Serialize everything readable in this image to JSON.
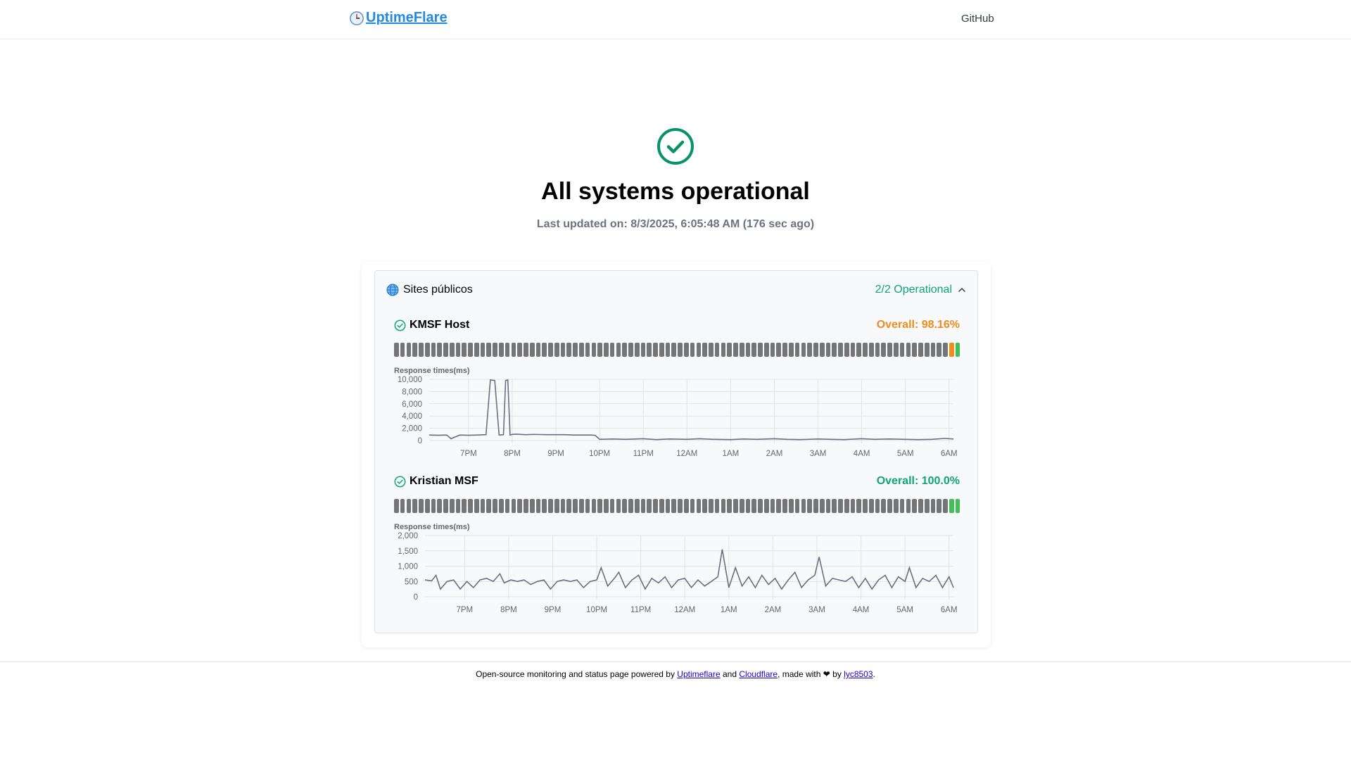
{
  "header": {
    "brand": "UptimeFlare",
    "github_label": "GitHub"
  },
  "hero": {
    "title": "All systems operational",
    "subtitle": "Last updated on: 8/3/2025, 6:05:48 AM (176 sec ago)"
  },
  "group": {
    "title": "Sites públicos",
    "status": "2/2 Operational"
  },
  "monitors": [
    {
      "name": "KMSF Host",
      "overall": "Overall: 98.16%",
      "overall_color": "#f08c1e",
      "response_label": "Response times(ms)",
      "bars": [
        "gray",
        "gray",
        "gray",
        "gray",
        "gray",
        "gray",
        "gray",
        "gray",
        "gray",
        "gray",
        "gray",
        "gray",
        "gray",
        "gray",
        "gray",
        "gray",
        "gray",
        "gray",
        "gray",
        "gray",
        "gray",
        "gray",
        "gray",
        "gray",
        "gray",
        "gray",
        "gray",
        "gray",
        "gray",
        "gray",
        "gray",
        "gray",
        "gray",
        "gray",
        "gray",
        "gray",
        "gray",
        "gray",
        "gray",
        "gray",
        "gray",
        "gray",
        "gray",
        "gray",
        "gray",
        "gray",
        "gray",
        "gray",
        "gray",
        "gray",
        "gray",
        "gray",
        "gray",
        "gray",
        "gray",
        "gray",
        "gray",
        "gray",
        "gray",
        "gray",
        "gray",
        "gray",
        "gray",
        "gray",
        "gray",
        "gray",
        "gray",
        "gray",
        "gray",
        "gray",
        "gray",
        "gray",
        "gray",
        "gray",
        "gray",
        "gray",
        "gray",
        "gray",
        "gray",
        "gray",
        "gray",
        "gray",
        "gray",
        "gray",
        "gray",
        "gray",
        "gray",
        "gray",
        "gray",
        "gray",
        "orange",
        "green"
      ]
    },
    {
      "name": "Kristian MSF",
      "overall": "Overall: 100.0%",
      "overall_color": "#0ca678",
      "response_label": "Response times(ms)",
      "bars": [
        "gray",
        "gray",
        "gray",
        "gray",
        "gray",
        "gray",
        "gray",
        "gray",
        "gray",
        "gray",
        "gray",
        "gray",
        "gray",
        "gray",
        "gray",
        "gray",
        "gray",
        "gray",
        "gray",
        "gray",
        "gray",
        "gray",
        "gray",
        "gray",
        "gray",
        "gray",
        "gray",
        "gray",
        "gray",
        "gray",
        "gray",
        "gray",
        "gray",
        "gray",
        "gray",
        "gray",
        "gray",
        "gray",
        "gray",
        "gray",
        "gray",
        "gray",
        "gray",
        "gray",
        "gray",
        "gray",
        "gray",
        "gray",
        "gray",
        "gray",
        "gray",
        "gray",
        "gray",
        "gray",
        "gray",
        "gray",
        "gray",
        "gray",
        "gray",
        "gray",
        "gray",
        "gray",
        "gray",
        "gray",
        "gray",
        "gray",
        "gray",
        "gray",
        "gray",
        "gray",
        "gray",
        "gray",
        "gray",
        "gray",
        "gray",
        "gray",
        "gray",
        "gray",
        "gray",
        "gray",
        "gray",
        "gray",
        "gray",
        "gray",
        "gray",
        "gray",
        "gray",
        "gray",
        "gray",
        "gray",
        "green",
        "green"
      ]
    }
  ],
  "chart_data": [
    {
      "type": "line",
      "title": "Response times(ms)",
      "x_tick_labels": [
        "7PM",
        "8PM",
        "9PM",
        "10PM",
        "11PM",
        "12AM",
        "1AM",
        "2AM",
        "3AM",
        "4AM",
        "5AM",
        "6AM"
      ],
      "y_tick_labels": [
        "0",
        "2,000",
        "4,000",
        "6,000",
        "8,000",
        "10,000"
      ],
      "ylim": [
        0,
        10000
      ],
      "x_range_hours": [
        18.1,
        30.1
      ],
      "x_hours": [
        18.1,
        18.3,
        18.5,
        18.6,
        18.8,
        19.0,
        19.2,
        19.4,
        19.5,
        19.6,
        19.7,
        19.8,
        19.85,
        19.9,
        19.95,
        20.0,
        20.1,
        20.3,
        20.5,
        20.8,
        21.0,
        21.2,
        21.4,
        21.6,
        21.8,
        21.9,
        22.0,
        22.3,
        22.6,
        23.0,
        23.3,
        23.6,
        24.0,
        24.3,
        24.6,
        25.0,
        25.3,
        25.6,
        26.0,
        26.3,
        26.6,
        27.0,
        27.3,
        27.6,
        28.0,
        28.3,
        28.6,
        29.0,
        29.3,
        29.6,
        29.9,
        30.1
      ],
      "values": [
        900,
        850,
        900,
        300,
        900,
        850,
        900,
        950,
        9900,
        9800,
        900,
        950,
        9800,
        9900,
        900,
        1000,
        1050,
        950,
        1000,
        950,
        950,
        950,
        900,
        900,
        900,
        850,
        200,
        250,
        200,
        300,
        150,
        250,
        200,
        300,
        200,
        150,
        250,
        200,
        300,
        200,
        150,
        250,
        200,
        150,
        300,
        200,
        250,
        200,
        150,
        200,
        350,
        250
      ],
      "grid": true
    },
    {
      "type": "line",
      "title": "Response times(ms)",
      "x_tick_labels": [
        "7PM",
        "8PM",
        "9PM",
        "10PM",
        "11PM",
        "12AM",
        "1AM",
        "2AM",
        "3AM",
        "4AM",
        "5AM",
        "6AM"
      ],
      "y_tick_labels": [
        "0",
        "500",
        "1,000",
        "1,500",
        "2,000"
      ],
      "ylim": [
        0,
        2000
      ],
      "x_range_hours": [
        18.1,
        30.1
      ],
      "x_hours": [
        18.1,
        18.25,
        18.35,
        18.45,
        18.6,
        18.75,
        18.9,
        19.05,
        19.2,
        19.35,
        19.5,
        19.65,
        19.8,
        19.9,
        20.05,
        20.2,
        20.35,
        20.5,
        20.65,
        20.8,
        20.95,
        21.1,
        21.25,
        21.4,
        21.55,
        21.7,
        21.85,
        22.0,
        22.1,
        22.25,
        22.4,
        22.5,
        22.65,
        22.8,
        22.95,
        23.1,
        23.25,
        23.4,
        23.55,
        23.7,
        23.85,
        24.0,
        24.15,
        24.3,
        24.45,
        24.6,
        24.75,
        24.85,
        25.0,
        25.15,
        25.3,
        25.45,
        25.6,
        25.75,
        25.9,
        26.05,
        26.2,
        26.35,
        26.5,
        26.65,
        26.8,
        26.95,
        27.05,
        27.2,
        27.35,
        27.5,
        27.65,
        27.8,
        27.95,
        28.1,
        28.25,
        28.4,
        28.55,
        28.7,
        28.85,
        29.0,
        29.1,
        29.25,
        29.4,
        29.55,
        29.7,
        29.85,
        30.0,
        30.1
      ],
      "values": [
        550,
        520,
        700,
        250,
        500,
        550,
        250,
        500,
        300,
        550,
        600,
        500,
        750,
        450,
        550,
        500,
        550,
        400,
        500,
        550,
        250,
        500,
        550,
        500,
        550,
        300,
        500,
        550,
        950,
        350,
        600,
        800,
        300,
        550,
        700,
        250,
        600,
        450,
        650,
        300,
        550,
        600,
        300,
        550,
        350,
        500,
        650,
        1550,
        300,
        950,
        350,
        650,
        300,
        700,
        400,
        600,
        250,
        550,
        800,
        300,
        550,
        700,
        1300,
        350,
        600,
        550,
        500,
        650,
        300,
        600,
        250,
        550,
        700,
        300,
        650,
        500,
        950,
        300,
        600,
        500,
        700,
        300,
        650,
        300
      ],
      "grid": true
    }
  ]
}
